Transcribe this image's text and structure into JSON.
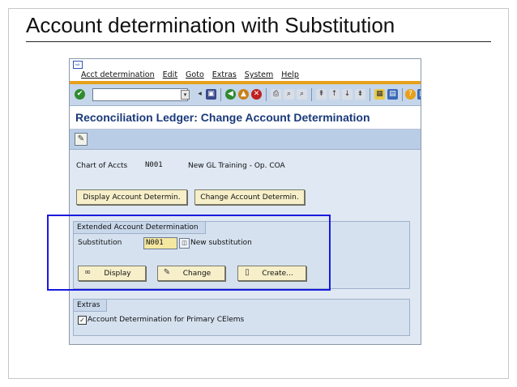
{
  "slide": {
    "title": "Account determination with Substitution"
  },
  "menu": {
    "items": [
      "Acct determination",
      "Edit",
      "Goto",
      "Extras",
      "System",
      "Help"
    ]
  },
  "screen": {
    "title": "Reconciliation Ledger: Change Account Determination"
  },
  "fields": {
    "chart_label": "Chart of Accts",
    "chart_value": "N001",
    "chart_desc": "New GL Training - Op. COA"
  },
  "buttons": {
    "display_acct": "Display Account Determin.",
    "change_acct": "Change Account Determin.",
    "display": "Display",
    "change": "Change",
    "create": "Create..."
  },
  "extended_group": {
    "title": "Extended Account Determination",
    "substitution_label": "Substitution",
    "substitution_value": "N001",
    "substitution_desc": "New substitution"
  },
  "extras_group": {
    "title": "Extras",
    "checkbox_label": "Account Determination for Primary CElems",
    "checked": true
  },
  "colors": {
    "highlight": "#1a1adf",
    "accent": "#e8a01a",
    "title": "#1a3a7a"
  }
}
